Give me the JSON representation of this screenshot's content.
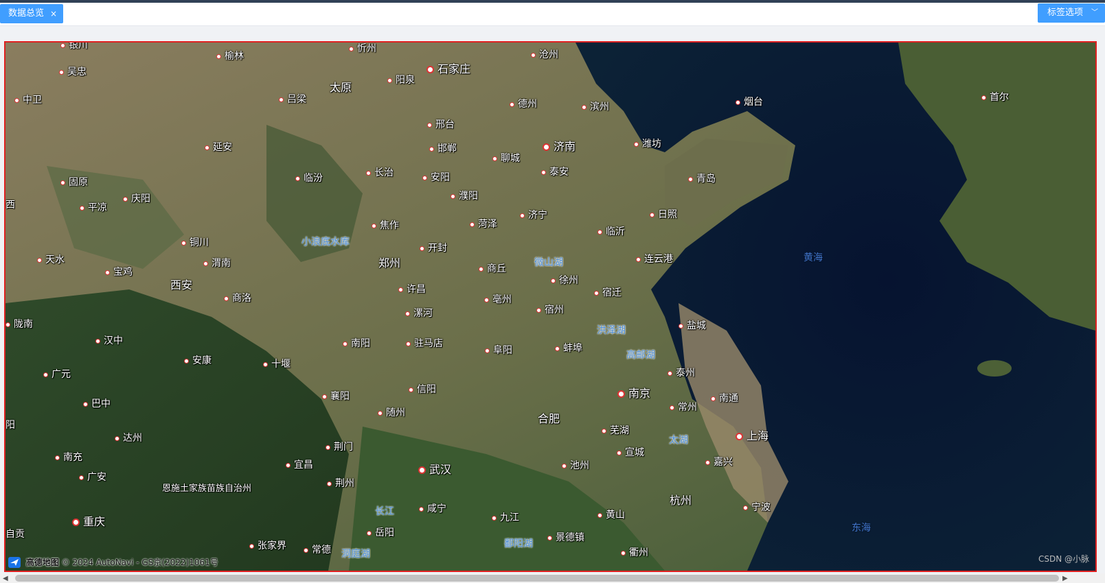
{
  "tabs": {
    "active_label": "数据总览",
    "close_glyph": "×",
    "options_label": "标签选项",
    "options_chevron": "﹀"
  },
  "map": {
    "provider_text": "高德地图",
    "copyright": "© 2024 AutoNavi - GS京(2022)1061号",
    "logo_icon": "amap-logo-icon",
    "cities": [
      {
        "name": "银川"
      },
      {
        "name": "榆林"
      },
      {
        "name": "忻州"
      },
      {
        "name": "沧州"
      },
      {
        "name": "吴忠"
      },
      {
        "name": "太原"
      },
      {
        "name": "阳泉"
      },
      {
        "name": "石家庄"
      },
      {
        "name": "中卫"
      },
      {
        "name": "吕梁"
      },
      {
        "name": "德州"
      },
      {
        "name": "滨州"
      },
      {
        "name": "烟台"
      },
      {
        "name": "首尔"
      },
      {
        "name": "邢台"
      },
      {
        "name": "延安"
      },
      {
        "name": "邯郸"
      },
      {
        "name": "济南"
      },
      {
        "name": "潍坊"
      },
      {
        "name": "聊城"
      },
      {
        "name": "长治"
      },
      {
        "name": "临汾"
      },
      {
        "name": "安阳"
      },
      {
        "name": "泰安"
      },
      {
        "name": "固原"
      },
      {
        "name": "青岛"
      },
      {
        "name": "庆阳"
      },
      {
        "name": "濮阳"
      },
      {
        "name": "平凉"
      },
      {
        "name": "西"
      },
      {
        "name": "日照"
      },
      {
        "name": "焦作"
      },
      {
        "name": "菏泽"
      },
      {
        "name": "济宁"
      },
      {
        "name": "临沂"
      },
      {
        "name": "铜川"
      },
      {
        "name": "开封"
      },
      {
        "name": "郑州"
      },
      {
        "name": "连云港"
      },
      {
        "name": "天水"
      },
      {
        "name": "渭南"
      },
      {
        "name": "商丘"
      },
      {
        "name": "宝鸡"
      },
      {
        "name": "徐州"
      },
      {
        "name": "西安"
      },
      {
        "name": "许昌"
      },
      {
        "name": "宿迁"
      },
      {
        "name": "商洛"
      },
      {
        "name": "亳州"
      },
      {
        "name": "宿州"
      },
      {
        "name": "漯河"
      },
      {
        "name": "陇南"
      },
      {
        "name": "盐城"
      },
      {
        "name": "汉中"
      },
      {
        "name": "南阳"
      },
      {
        "name": "驻马店"
      },
      {
        "name": "阜阳"
      },
      {
        "name": "蚌埠"
      },
      {
        "name": "安康"
      },
      {
        "name": "十堰"
      },
      {
        "name": "泰州"
      },
      {
        "name": "广元"
      },
      {
        "name": "信阳"
      },
      {
        "name": "南京"
      },
      {
        "name": "襄阳"
      },
      {
        "name": "南通"
      },
      {
        "name": "巴中"
      },
      {
        "name": "随州"
      },
      {
        "name": "合肥"
      },
      {
        "name": "常州"
      },
      {
        "name": "阳"
      },
      {
        "name": "芜湖"
      },
      {
        "name": "上海"
      },
      {
        "name": "达州"
      },
      {
        "name": "荆门"
      },
      {
        "name": "宣城"
      },
      {
        "name": "南充"
      },
      {
        "name": "嘉兴"
      },
      {
        "name": "宜昌"
      },
      {
        "name": "武汉"
      },
      {
        "name": "池州"
      },
      {
        "name": "广安"
      },
      {
        "name": "荆州"
      },
      {
        "name": "恩施土家族苗族自治州"
      },
      {
        "name": "杭州"
      },
      {
        "name": "咸宁"
      },
      {
        "name": "宁波"
      },
      {
        "name": "黄山"
      },
      {
        "name": "九江"
      },
      {
        "name": "重庆"
      },
      {
        "name": "自贡"
      },
      {
        "name": "岳阳"
      },
      {
        "name": "景德镇"
      },
      {
        "name": "张家界"
      },
      {
        "name": "常德"
      },
      {
        "name": "衢州"
      }
    ],
    "water_labels": [
      {
        "name": "小浪底水库"
      },
      {
        "name": "微山湖"
      },
      {
        "name": "黄海"
      },
      {
        "name": "洪泽湖"
      },
      {
        "name": "高邮湖"
      },
      {
        "name": "太湖"
      },
      {
        "name": "长江"
      },
      {
        "name": "鄱阳湖"
      },
      {
        "name": "洞庭湖"
      },
      {
        "name": "东海"
      }
    ]
  },
  "footer": {
    "watermark": "CSDN @小脉",
    "scroll_left": "◀",
    "scroll_right": "▶"
  }
}
